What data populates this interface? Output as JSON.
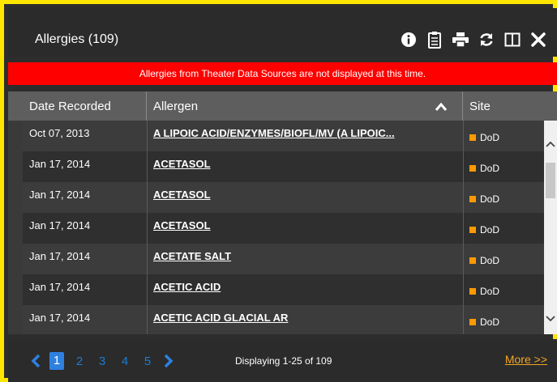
{
  "header": {
    "title": "Allergies (109)"
  },
  "toolbar": {
    "icons": [
      "info-icon",
      "clipboard-icon",
      "print-icon",
      "refresh-icon",
      "columns-icon",
      "close-icon"
    ]
  },
  "banner": {
    "text": "Allergies from Theater Data Sources are not displayed at this time."
  },
  "table": {
    "columns": [
      "Date Recorded",
      "Allergen",
      "Site"
    ],
    "rows": [
      {
        "date": "Oct 07, 2013",
        "allergen": "A LIPOIC ACID/ENZYMES/BIOFL/MV (A LIPOIC...",
        "site": "DoD"
      },
      {
        "date": "Jan 17, 2014",
        "allergen": "ACETASOL",
        "site": "DoD"
      },
      {
        "date": "Jan 17, 2014",
        "allergen": "ACETASOL",
        "site": "DoD"
      },
      {
        "date": "Jan 17, 2014",
        "allergen": "ACETASOL",
        "site": "DoD"
      },
      {
        "date": "Jan 17, 2014",
        "allergen": "ACETATE SALT",
        "site": "DoD"
      },
      {
        "date": "Jan 17, 2014",
        "allergen": "ACETIC ACID",
        "site": "DoD"
      },
      {
        "date": "Jan 17, 2014",
        "allergen": "ACETIC ACID GLACIAL AR",
        "site": "DoD"
      }
    ]
  },
  "footer": {
    "pages": [
      "1",
      "2",
      "3",
      "4",
      "5"
    ],
    "active_page": "1",
    "display_text": "Displaying 1-25 of 109",
    "more_label": "More >>"
  },
  "colors": {
    "border": "#ffe600",
    "banner": "#ff0000",
    "site_marker": "#ff9900",
    "active_page": "#2e80e0",
    "link_page": "#1e7bd1",
    "more_link": "#f5a623"
  }
}
